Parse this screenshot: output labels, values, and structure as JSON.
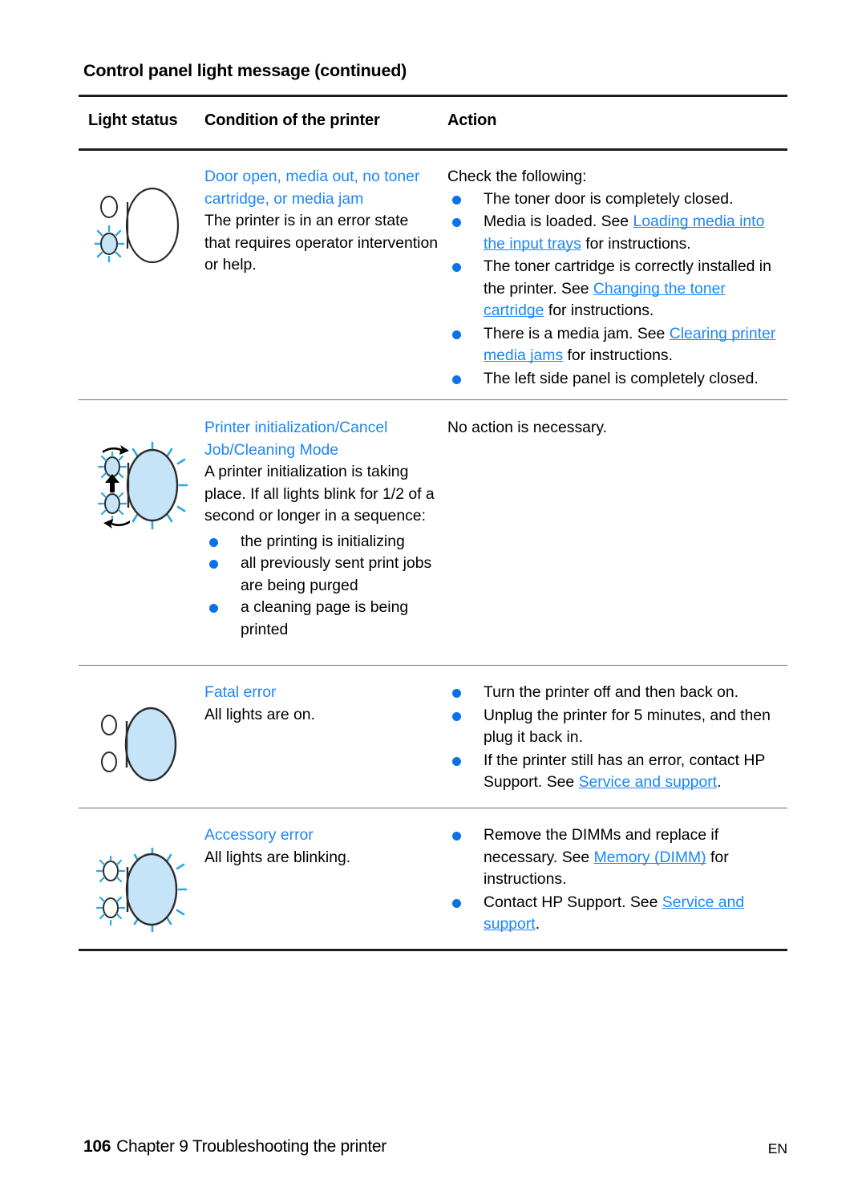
{
  "document": {
    "table_title": "Control panel light message (continued)",
    "columns": {
      "light_status": "Light status",
      "condition": "Condition of the printer",
      "action": "Action"
    }
  },
  "colors": {
    "link_blue": "#1e86f7",
    "bullet_blue": "#0a72e8",
    "led_fill": "#c6e4f8",
    "ray_blue": "#2aa9e8",
    "rule_heavy": "#1b1b1b",
    "rule_light": "#6e6e6e"
  },
  "rows": [
    {
      "icon_name": "control-panel-lights-attention-blinking",
      "condition": {
        "heading": "Door open, media out, no toner cartridge, or media jam",
        "body": "The printer is in an error state that requires operator intervention or help."
      },
      "action": {
        "intro": "Check the following:",
        "bullets": [
          {
            "parts": [
              {
                "t": "The toner door is completely closed.",
                "link": false
              }
            ]
          },
          {
            "parts": [
              {
                "t": "Media is loaded. See ",
                "link": false
              },
              {
                "t": "Loading media into the input trays",
                "link": true
              },
              {
                "t": " for instructions.",
                "link": false
              }
            ]
          },
          {
            "parts": [
              {
                "t": "The toner cartridge is correctly installed in the printer. See ",
                "link": false
              },
              {
                "t": "Changing the toner cartridge",
                "link": true
              },
              {
                "t": " for instructions.",
                "link": false
              }
            ]
          },
          {
            "parts": [
              {
                "t": "There is a media jam. See ",
                "link": false
              },
              {
                "t": "Clearing printer media jams",
                "link": true
              },
              {
                "t": " for instructions.",
                "link": false
              }
            ]
          },
          {
            "parts": [
              {
                "t": "The left side panel is completely closed.",
                "link": false
              }
            ]
          }
        ]
      }
    },
    {
      "icon_name": "control-panel-lights-sequence-blinking",
      "condition": {
        "heading": "Printer initialization/Cancel Job/Cleaning Mode",
        "body": "A printer initialization is taking place. If all lights blink for 1/2 of a second or longer in a sequence:",
        "bullets": [
          "the printing is initializing",
          "all previously sent print jobs are being purged",
          "a cleaning page is being printed"
        ]
      },
      "action": {
        "intro": "No action is necessary.",
        "bullets": []
      }
    },
    {
      "icon_name": "control-panel-lights-all-on",
      "condition": {
        "heading": "Fatal error",
        "body": "All lights are on."
      },
      "action": {
        "intro": "",
        "bullets": [
          {
            "parts": [
              {
                "t": "Turn the printer off and then back on.",
                "link": false
              }
            ]
          },
          {
            "parts": [
              {
                "t": "Unplug the printer for 5 minutes, and then plug it back in.",
                "link": false
              }
            ]
          },
          {
            "parts": [
              {
                "t": "If the printer still has an error, contact HP Support. See ",
                "link": false
              },
              {
                "t": "Service and support",
                "link": true
              },
              {
                "t": ".",
                "link": false
              }
            ]
          }
        ]
      }
    },
    {
      "icon_name": "control-panel-lights-all-blinking",
      "condition": {
        "heading": "Accessory error",
        "body": "All lights are blinking."
      },
      "action": {
        "intro": "",
        "bullets": [
          {
            "parts": [
              {
                "t": "Remove the DIMMs and replace if necessary. See ",
                "link": false
              },
              {
                "t": "Memory (DIMM)",
                "link": true
              },
              {
                "t": " for instructions.",
                "link": false
              }
            ]
          },
          {
            "parts": [
              {
                "t": "Contact HP Support. See ",
                "link": false
              },
              {
                "t": "Service and support",
                "link": true
              },
              {
                "t": ".",
                "link": false
              }
            ]
          }
        ]
      }
    }
  ],
  "footer": {
    "page_number": "106",
    "chapter_text": "Chapter 9 Troubleshooting the printer",
    "language_code": "EN"
  }
}
